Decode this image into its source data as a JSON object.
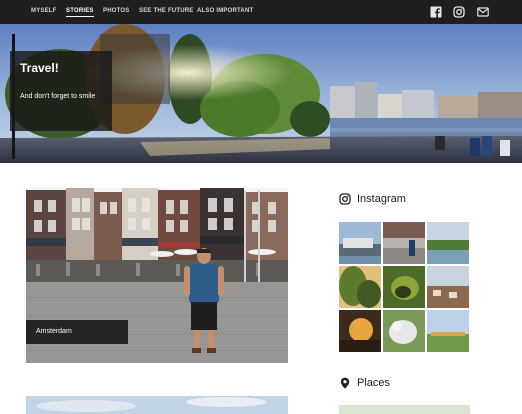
{
  "nav": {
    "items": [
      {
        "label": "MYSELF",
        "active": false
      },
      {
        "label": "STORIES",
        "active": true
      },
      {
        "label": "PHOTOS",
        "active": false
      },
      {
        "label": "SEE THE FUTURE",
        "active": false
      },
      {
        "label": "ALSO IMPORTANT",
        "active": false
      }
    ],
    "icons": [
      "facebook-icon",
      "instagram-icon",
      "mail-icon"
    ]
  },
  "hero": {
    "title": "Travel!",
    "subtitle": "And don't forget to smile"
  },
  "post": {
    "label": "Amsterdam"
  },
  "sidebar": {
    "instagram_heading": "Instagram",
    "places_heading": "Places"
  },
  "colors": {
    "nav_bg": "#1e1f21",
    "overlay": "#191919"
  }
}
